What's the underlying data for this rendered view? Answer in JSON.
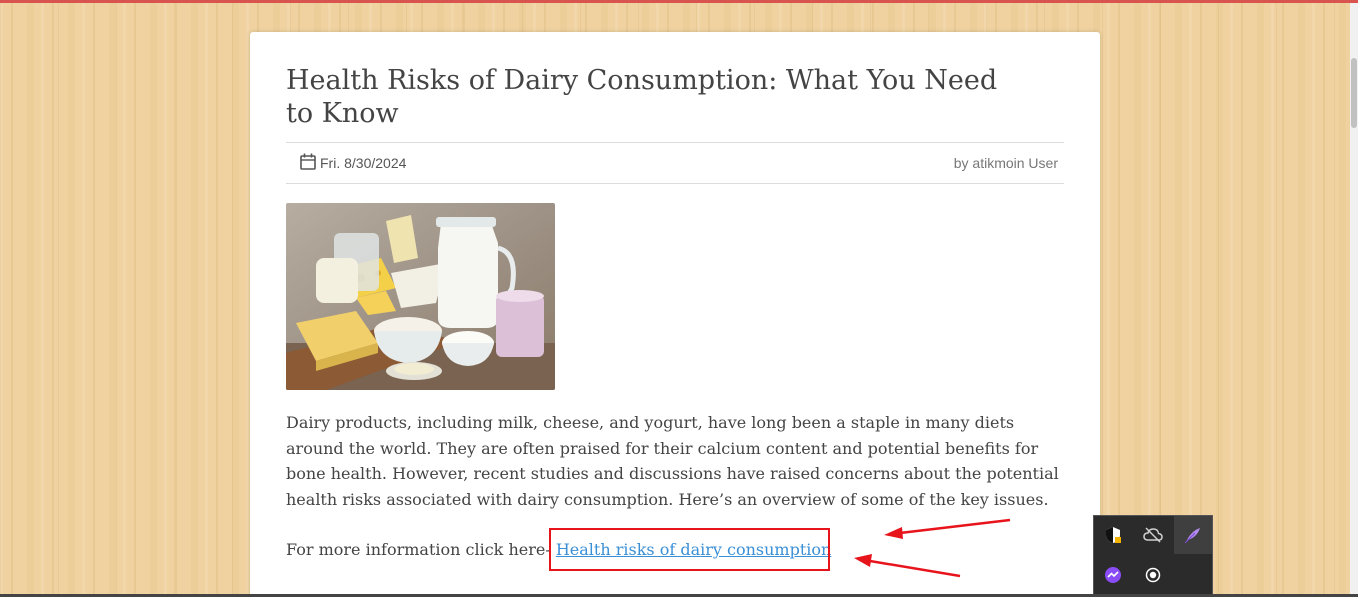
{
  "post": {
    "title": "Health Risks of Dairy Consumption: What You Need to Know",
    "date": "Fri. 8/30/2024",
    "author": "by atikmoin User",
    "body": "Dairy products, including milk, cheese, and yogurt, have long been a staple in many diets around the world. They are often praised for their calcium content and potential benefits for bone health. However, recent studies and discussions have raised concerns about the potential health risks associated with dairy consumption. Here’s an overview of some of the key issues.",
    "more_info_prefix": "For more information click here- ",
    "more_info_link": "Health risks of dairy consumption"
  },
  "icons": {
    "meta": "calendar-icon",
    "tray": [
      "security-shield-icon",
      "cloud-offline-icon",
      "feather-pen-icon",
      "messenger-icon",
      "record-circle-icon"
    ]
  },
  "colors": {
    "accent_bar": "#d9534f",
    "link": "#3a8fd6",
    "annotation": "#e8141c",
    "tray_bg": "#2b2b2b"
  }
}
